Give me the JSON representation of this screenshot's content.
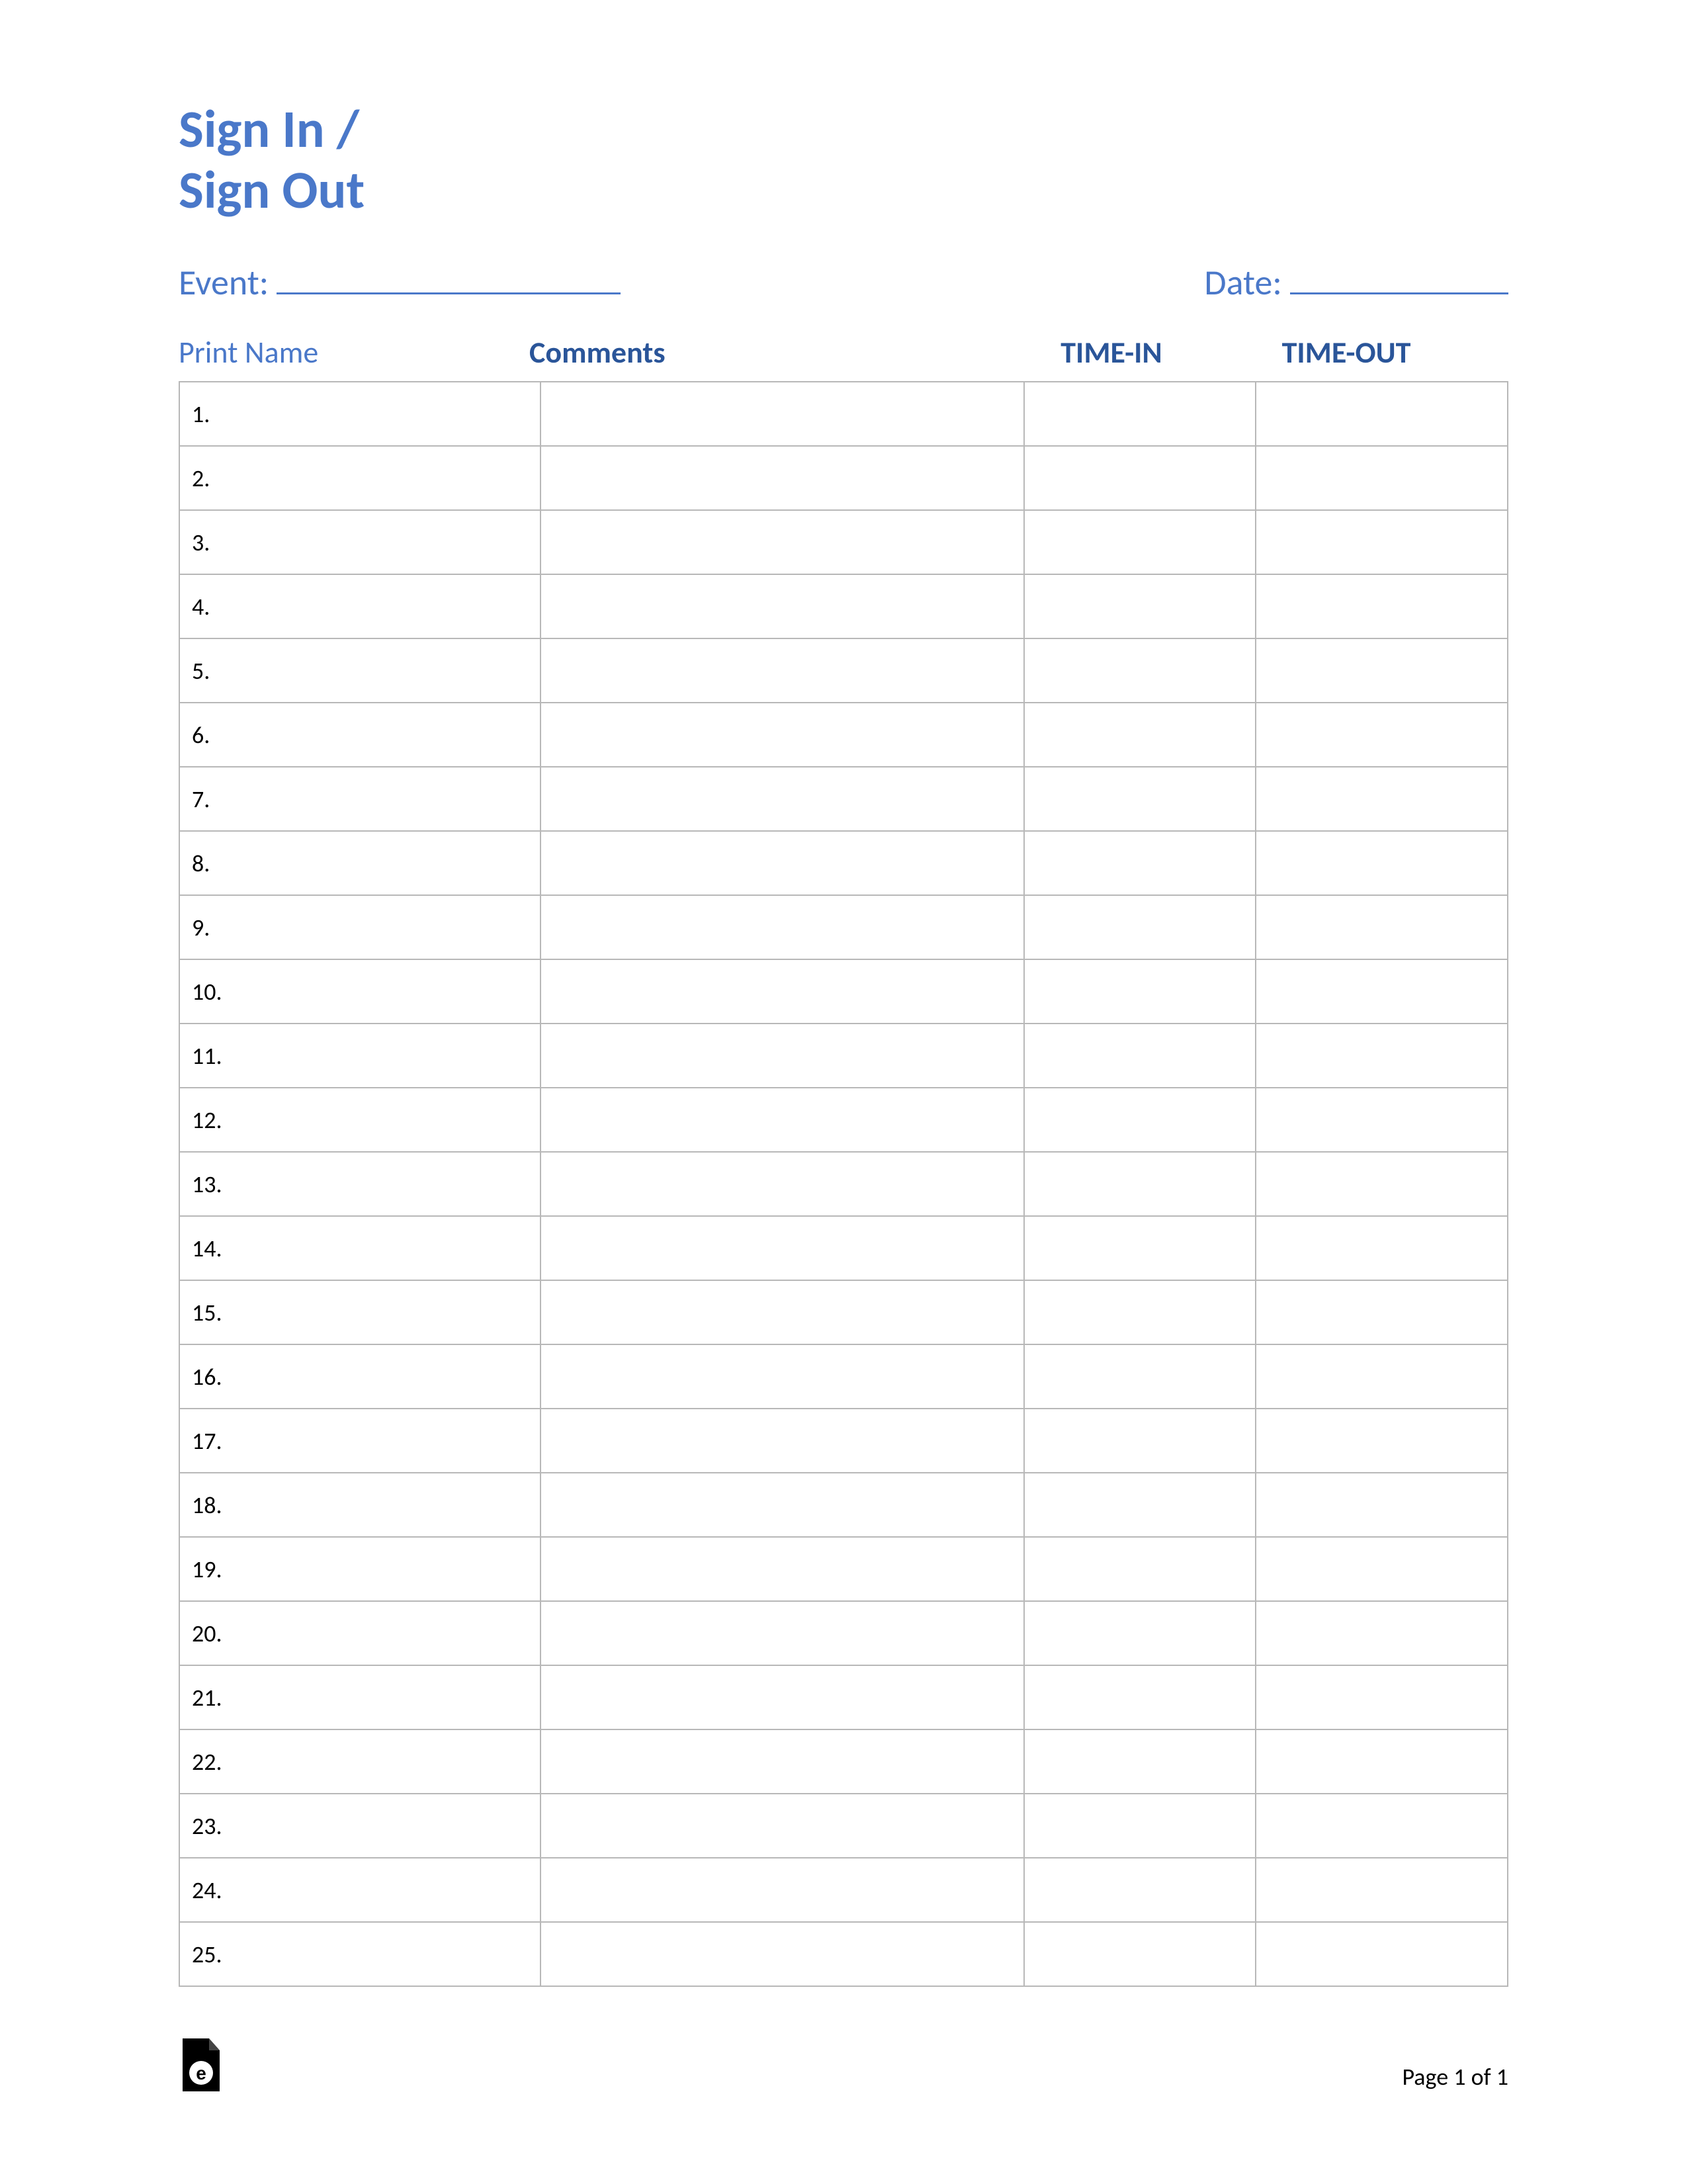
{
  "title_line1": "Sign In /",
  "title_line2": "Sign Out",
  "event_label": "Event: ",
  "date_label": "Date: ",
  "headers": {
    "print_name": "Print Name",
    "comments": "Comments",
    "time_in": "TIME-IN",
    "time_out": "TIME-OUT"
  },
  "rows": [
    "1.",
    "2.",
    "3.",
    "4.",
    "5.",
    "6.",
    "7.",
    "8.",
    "9.",
    "10.",
    "11.",
    "12.",
    "13.",
    "14.",
    "15.",
    "16.",
    "17.",
    "18.",
    "19.",
    "20.",
    "21.",
    "22.",
    "23.",
    "24.",
    "25."
  ],
  "page_number": "Page 1 of 1"
}
